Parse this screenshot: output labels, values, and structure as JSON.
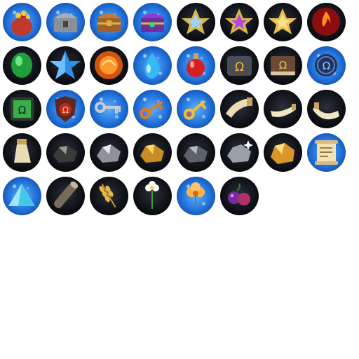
{
  "sprite_sheet": {
    "icons": [
      {
        "name": "gold-sack-icon",
        "bg": "blue"
      },
      {
        "name": "iron-chest-icon",
        "bg": "blue"
      },
      {
        "name": "wooden-chest-icon",
        "bg": "blue"
      },
      {
        "name": "purple-chest-icon",
        "bg": "blue"
      },
      {
        "name": "silver-star-emblem-icon",
        "bg": "dark"
      },
      {
        "name": "purple-star-emblem-icon",
        "bg": "dark"
      },
      {
        "name": "gold-star-emblem-icon",
        "bg": "dark"
      },
      {
        "name": "fire-orb-icon",
        "bg": "dark"
      },
      {
        "name": "green-gem-icon",
        "bg": "dark"
      },
      {
        "name": "blue-star-icon",
        "bg": "dark"
      },
      {
        "name": "orange-orb-icon",
        "bg": "dark"
      },
      {
        "name": "water-drop-icon",
        "bg": "blue"
      },
      {
        "name": "red-potion-icon",
        "bg": "blue"
      },
      {
        "name": "omega-rune-stone-icon",
        "bg": "dark"
      },
      {
        "name": "omega-rune-book-icon",
        "bg": "dark"
      },
      {
        "name": "omega-rune-disc-icon",
        "bg": "blue"
      },
      {
        "name": "green-omega-tile-icon",
        "bg": "dark"
      },
      {
        "name": "red-omega-shield-icon",
        "bg": "blue"
      },
      {
        "name": "silver-key-icon",
        "bg": "blue"
      },
      {
        "name": "bronze-key-icon",
        "bg": "blue"
      },
      {
        "name": "gold-key-icon",
        "bg": "blue"
      },
      {
        "name": "war-horn-icon",
        "bg": "dark"
      },
      {
        "name": "small-horn-icon",
        "bg": "dark"
      },
      {
        "name": "curved-horn-icon",
        "bg": "dark"
      },
      {
        "name": "cup-horn-icon",
        "bg": "dark"
      },
      {
        "name": "coal-ore-icon",
        "bg": "dark"
      },
      {
        "name": "silver-ore-icon",
        "bg": "dark"
      },
      {
        "name": "gold-ore-icon",
        "bg": "dark"
      },
      {
        "name": "iron-ore-icon",
        "bg": "dark"
      },
      {
        "name": "sparkling-ore-icon",
        "bg": "dark"
      },
      {
        "name": "gold-nugget-icon",
        "bg": "dark"
      },
      {
        "name": "scroll-icon",
        "bg": "blue"
      },
      {
        "name": "crystal-shard-icon",
        "bg": "blue"
      },
      {
        "name": "wood-log-icon",
        "bg": "dark"
      },
      {
        "name": "wheat-icon",
        "bg": "dark"
      },
      {
        "name": "white-flower-icon",
        "bg": "dark"
      },
      {
        "name": "orange-flower-icon",
        "bg": "blue"
      },
      {
        "name": "purple-berries-icon",
        "bg": "dark"
      }
    ]
  }
}
